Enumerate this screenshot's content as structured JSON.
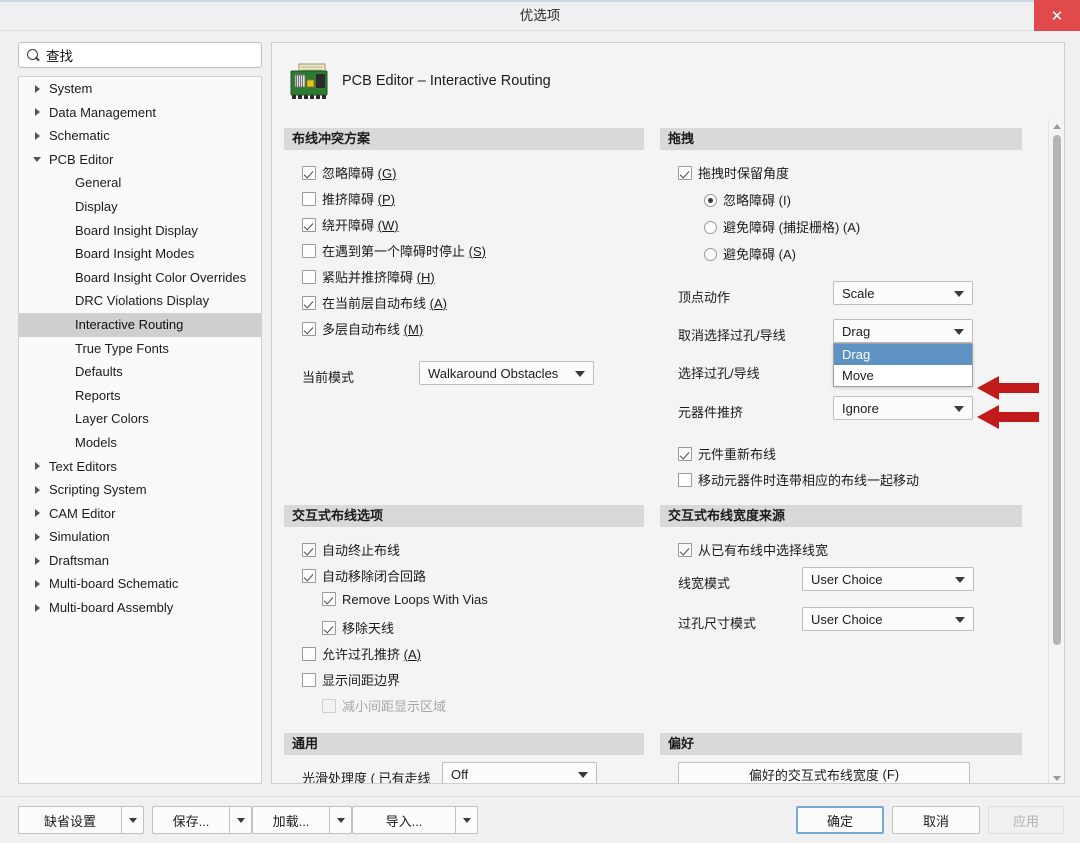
{
  "window": {
    "title": "优选项",
    "close_label": "✕"
  },
  "search": {
    "value": "查找",
    "icon": "search-icon"
  },
  "tree": {
    "items": [
      {
        "label": "System",
        "level": 0,
        "state": "collapsed"
      },
      {
        "label": "Data Management",
        "level": 0,
        "state": "collapsed"
      },
      {
        "label": "Schematic",
        "level": 0,
        "state": "collapsed"
      },
      {
        "label": "PCB Editor",
        "level": 0,
        "state": "expanded"
      },
      {
        "label": "General",
        "level": 1,
        "state": "leaf"
      },
      {
        "label": "Display",
        "level": 1,
        "state": "leaf"
      },
      {
        "label": "Board Insight Display",
        "level": 1,
        "state": "leaf"
      },
      {
        "label": "Board Insight Modes",
        "level": 1,
        "state": "leaf"
      },
      {
        "label": "Board Insight Color Overrides",
        "level": 1,
        "state": "leaf"
      },
      {
        "label": "DRC Violations Display",
        "level": 1,
        "state": "leaf"
      },
      {
        "label": "Interactive Routing",
        "level": 1,
        "state": "leaf",
        "selected": true
      },
      {
        "label": "True Type Fonts",
        "level": 1,
        "state": "leaf"
      },
      {
        "label": "Defaults",
        "level": 1,
        "state": "leaf"
      },
      {
        "label": "Reports",
        "level": 1,
        "state": "leaf"
      },
      {
        "label": "Layer Colors",
        "level": 1,
        "state": "leaf"
      },
      {
        "label": "Models",
        "level": 1,
        "state": "leaf"
      },
      {
        "label": "Text Editors",
        "level": 0,
        "state": "collapsed"
      },
      {
        "label": "Scripting System",
        "level": 0,
        "state": "collapsed"
      },
      {
        "label": "CAM Editor",
        "level": 0,
        "state": "collapsed"
      },
      {
        "label": "Simulation",
        "level": 0,
        "state": "collapsed"
      },
      {
        "label": "Draftsman",
        "level": 0,
        "state": "collapsed"
      },
      {
        "label": "Multi-board Schematic",
        "level": 0,
        "state": "collapsed"
      },
      {
        "label": "Multi-board Assembly",
        "level": 0,
        "state": "collapsed"
      }
    ]
  },
  "page": {
    "icon": "pcb-board-icon",
    "title": "PCB Editor – Interactive Routing"
  },
  "routing_conflict": {
    "header": "布线冲突方案",
    "checkboxes": [
      {
        "label": "忽略障碍",
        "mnemonic": "G",
        "checked": true
      },
      {
        "label": "推挤障碍",
        "mnemonic": "P",
        "checked": false
      },
      {
        "label": "绕开障碍",
        "mnemonic": "W",
        "checked": true
      },
      {
        "label": "在遇到第一个障碍时停止",
        "mnemonic": "S",
        "checked": false
      },
      {
        "label": "紧贴并推挤障碍",
        "mnemonic": "H",
        "checked": false
      },
      {
        "label": "在当前层自动布线",
        "mnemonic": "A",
        "checked": true
      },
      {
        "label": "多层自动布线",
        "mnemonic": "M",
        "checked": true
      }
    ],
    "current_mode_label": "当前模式",
    "current_mode_value": "Walkaround Obstacles"
  },
  "drag": {
    "header": "拖拽",
    "preserve_angle": {
      "label": "拖拽时保留角度",
      "checked": true
    },
    "radios": [
      {
        "label": "忽略障碍",
        "mnemonic": "I",
        "selected": true
      },
      {
        "label": "避免障碍 (捕捉栅格)",
        "mnemonic": "A",
        "selected": false
      },
      {
        "label": "避免障碍",
        "mnemonic": "A",
        "selected": false
      }
    ],
    "vertex_action": {
      "label": "顶点动作",
      "value": "Scale"
    },
    "unselected_via_wire": {
      "label": "取消选择过孔/导线",
      "value": "Drag"
    },
    "selected_via_wire": {
      "label": "选择过孔/导线",
      "value": ""
    },
    "component_pushing": {
      "label": "元器件推挤",
      "value": "Ignore"
    },
    "open_dropdown": {
      "options": [
        "Drag",
        "Move"
      ],
      "highlighted": "Drag"
    },
    "checkboxes": [
      {
        "label": "元件重新布线",
        "checked": true
      },
      {
        "label": "移动元器件时连带相应的布线一起移动",
        "checked": false
      }
    ]
  },
  "interactive_routing_options": {
    "header": "交互式布线选项",
    "checkboxes": [
      {
        "label": "自动终止布线",
        "mnemonic": "",
        "checked": true,
        "indent": 0,
        "disabled": false
      },
      {
        "label": "自动移除闭合回路",
        "mnemonic": "",
        "checked": true,
        "indent": 0,
        "disabled": false
      },
      {
        "label": "Remove Loops With Vias",
        "mnemonic": "",
        "checked": true,
        "indent": 1,
        "disabled": false
      },
      {
        "label": "移除天线",
        "mnemonic": "",
        "checked": true,
        "indent": 1,
        "disabled": false
      },
      {
        "label": "允许过孔推挤",
        "mnemonic": "A",
        "checked": false,
        "indent": 0,
        "disabled": false
      },
      {
        "label": "显示间距边界",
        "mnemonic": "",
        "checked": false,
        "indent": 0,
        "disabled": false
      },
      {
        "label": "减小间距显示区域",
        "mnemonic": "",
        "checked": false,
        "indent": 1,
        "disabled": true
      }
    ]
  },
  "width_source": {
    "header": "交互式布线宽度来源",
    "checkbox": {
      "label": "从已有布线中选择线宽",
      "checked": true
    },
    "rows": [
      {
        "label": "线宽模式",
        "value": "User Choice"
      },
      {
        "label": "过孔尺寸模式",
        "value": "User Choice"
      }
    ]
  },
  "general": {
    "header": "通用",
    "row_label": "光滑处理度 ( 已有走线",
    "row_value": "Off"
  },
  "preference": {
    "header": "偏好",
    "button_label": "偏好的交互式布线宽度",
    "button_mnemonic": "F"
  },
  "bottom": {
    "split_buttons": [
      {
        "label": "缺省设置",
        "width": 104
      },
      {
        "label": "保存...",
        "width": 78
      },
      {
        "label": "加载...",
        "width": 78
      },
      {
        "label": "导入...",
        "width": 104
      }
    ],
    "ok": "确定",
    "cancel": "取消",
    "apply": "应用"
  },
  "colors": {
    "accent_selection": "#5d92c2",
    "close_button": "#e04a4a",
    "section_header_bg": "#d9d9d9",
    "annotation_arrow": "#c01a1a"
  }
}
